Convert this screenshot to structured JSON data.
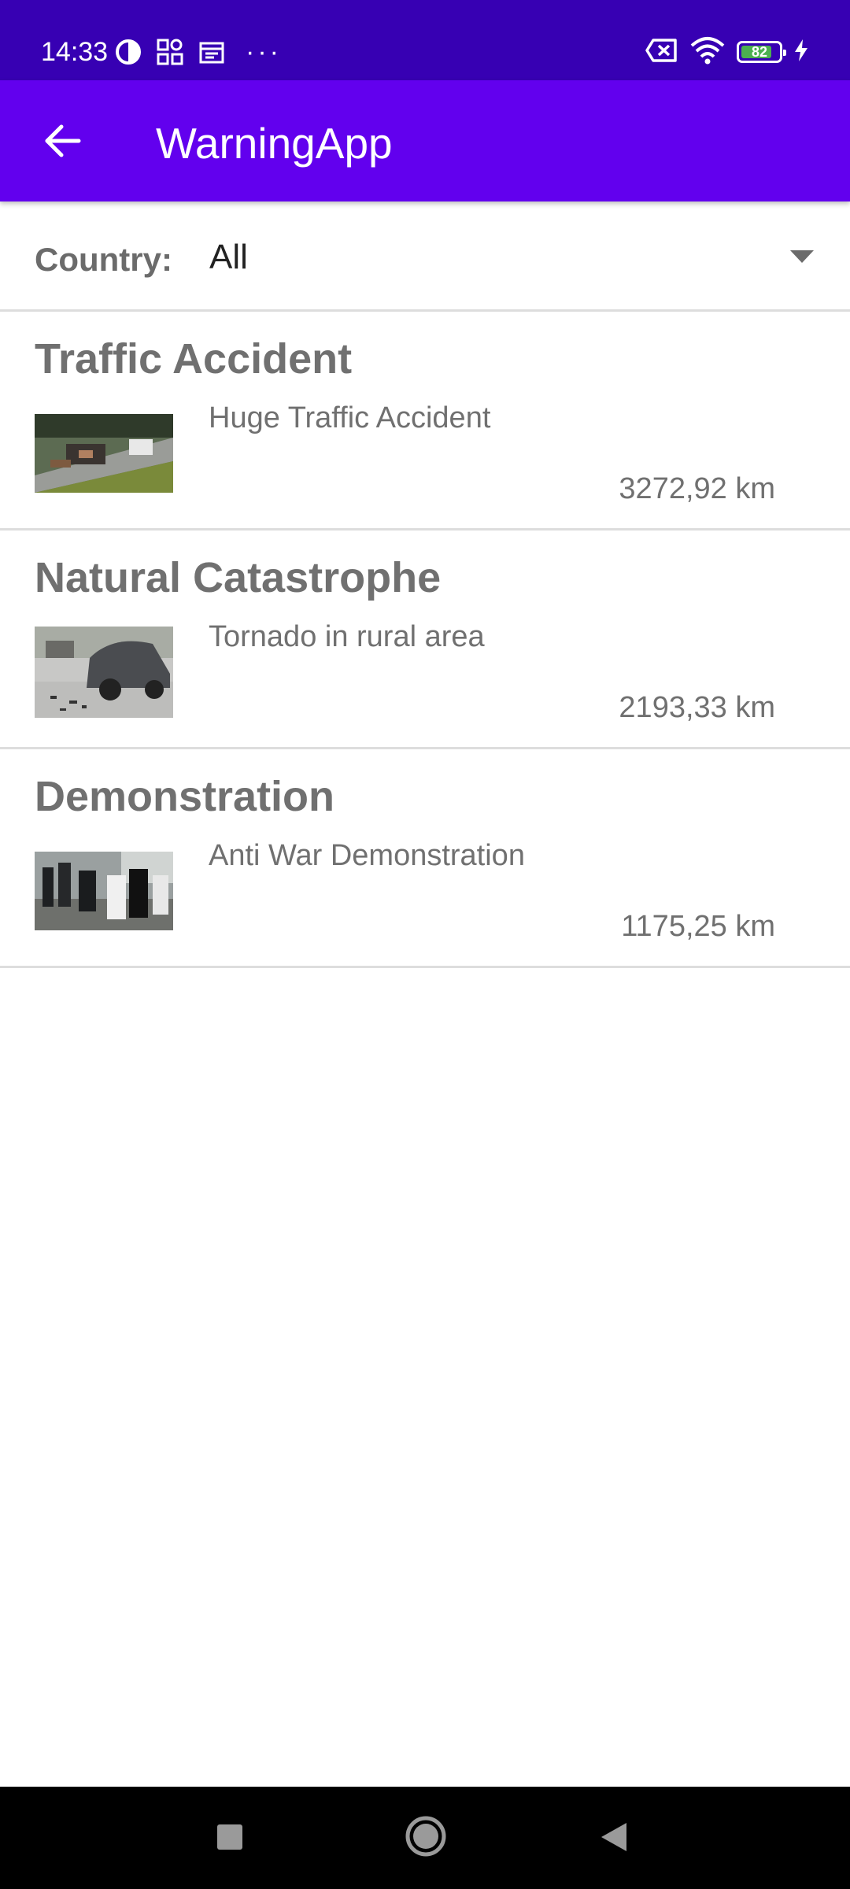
{
  "status_bar": {
    "time": "14:33",
    "battery_level": "82",
    "battery_fraction": 0.82,
    "icons": [
      "data-saver-icon",
      "grid-apps-icon",
      "calendar-icon",
      "more-dots-icon",
      "sim-blocked-icon",
      "wifi-icon",
      "battery-icon",
      "charging-icon"
    ],
    "more_dots": "···"
  },
  "app_bar": {
    "title": "WarningApp",
    "back_icon": "arrow-back-icon",
    "color": "#6200ee",
    "status_color": "#3700b3"
  },
  "filter": {
    "label": "Country:",
    "selected": "All",
    "dropdown_icon": "triangle-down-icon"
  },
  "warnings": [
    {
      "title": "Traffic Accident",
      "description": "Huge Traffic Accident",
      "distance": "3272,92 km",
      "thumbnail": "traffic-accident-photo"
    },
    {
      "title": "Natural Catastrophe",
      "description": "Tornado in rural area",
      "distance": "2193,33 km",
      "thumbnail": "car-crash-photo"
    },
    {
      "title": "Demonstration",
      "description": "Anti War Demonstration",
      "distance": "1175,25 km",
      "thumbnail": "riot-police-photo"
    }
  ],
  "nav_bar": {
    "buttons": [
      "recents-square-icon",
      "home-circle-icon",
      "back-triangle-icon"
    ]
  }
}
